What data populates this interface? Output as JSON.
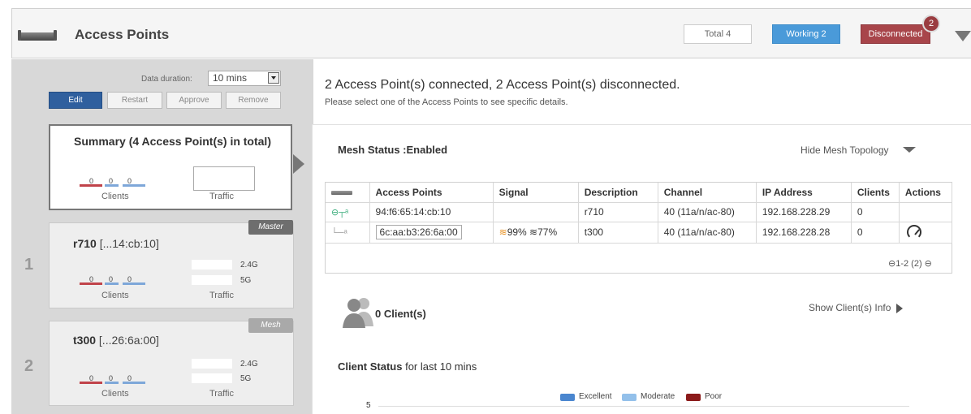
{
  "header": {
    "title": "Access Points",
    "total_label": "Total 4",
    "working_label": "Working 2",
    "disconnected_label": "Disconnected",
    "disconnected_badge": "2"
  },
  "controls": {
    "duration_label": "Data duration:",
    "duration_value": "10 mins",
    "edit_label": "Edit",
    "restart_label": "Restart",
    "approve_label": "Approve",
    "remove_label": "Remove"
  },
  "summary": {
    "title": "Summary (4 Access Point(s) in total)",
    "clients_label": "Clients",
    "traffic_label": "Traffic",
    "counts": [
      "0",
      "0",
      "0"
    ]
  },
  "aps": [
    {
      "index": "1",
      "role": "Master",
      "name": "r710",
      "mac_short": " [...14:cb:10]",
      "band_24": "2.4G",
      "band_5": "5G",
      "counts": [
        "0",
        "0",
        "0"
      ],
      "clients_label": "Clients",
      "traffic_label": "Traffic"
    },
    {
      "index": "2",
      "role": "Mesh",
      "name": "t300",
      "mac_short": " [...26:6a:00]",
      "band_24": "2.4G",
      "band_5": "5G",
      "counts": [
        "0",
        "0",
        "0"
      ],
      "clients_label": "Clients",
      "traffic_label": "Traffic"
    }
  ],
  "main": {
    "status_line": "2 Access Point(s) connected, 2 Access Point(s) disconnected.",
    "status_sub": "Please select one of the Access Points to see specific details.",
    "mesh_status": "Mesh Status :Enabled",
    "hide_mesh": "Hide Mesh Topology",
    "pager": "⊖1-2 (2) ⊖",
    "clients_count": "0 Client(s)",
    "show_clients": "Show Client(s) Info",
    "client_status_bold": "Client Status",
    "client_status_rest": " for last 10 mins"
  },
  "table": {
    "headers": [
      "Access Points",
      "Signal",
      "Description",
      "Channel",
      "IP Address",
      "Clients",
      "Actions"
    ],
    "rows": [
      {
        "ap": "94:f6:65:14:cb:10",
        "signal": "",
        "description": "r710",
        "channel": "40 (11a/n/ac-80)",
        "ip": "192.168.228.29",
        "clients": "0"
      },
      {
        "ap": "6c:aa:b3:26:6a:00",
        "signal": "99% ≋77%",
        "description": "t300",
        "channel": "40 (11a/n/ac-80)",
        "ip": "192.168.228.28",
        "clients": "0"
      }
    ]
  },
  "legend": {
    "items": [
      {
        "label": "Excellent",
        "color": "#4a86cf"
      },
      {
        "label": "Moderate",
        "color": "#93c0ea"
      },
      {
        "label": "Poor",
        "color": "#8b1a1a"
      }
    ],
    "y_tick": "5"
  },
  "colors": {
    "working": "#4a9ad9",
    "disconnected": "#a8454a",
    "edit": "#2f5f9e"
  }
}
